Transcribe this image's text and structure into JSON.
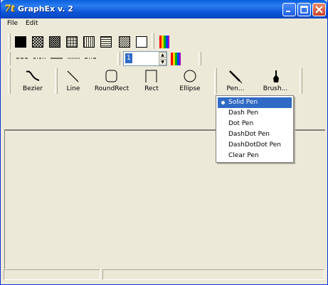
{
  "window": {
    "title": "GraphEx v. 2",
    "app_icon": "7t-app-icon"
  },
  "menu": {
    "items": [
      "File",
      "Edit"
    ]
  },
  "brushes": {
    "styles": [
      "solid",
      "diag-cross",
      "cross-hatch",
      "grid",
      "vertical",
      "horizontal",
      "diagonal",
      "clear"
    ],
    "palette_icon": "color-palette-icon"
  },
  "pen_styles": {
    "items": [
      "dash",
      "dot",
      "solid",
      "dotted",
      "dashdot"
    ]
  },
  "spin": {
    "value": "1"
  },
  "shapes": [
    {
      "label": "Bezier",
      "icon": "bezier-icon"
    },
    {
      "label": "Line",
      "icon": "line-icon"
    },
    {
      "label": "RoundRect",
      "icon": "roundrect-icon"
    },
    {
      "label": "Rect",
      "icon": "rect-icon"
    },
    {
      "label": "Ellipse",
      "icon": "ellipse-icon"
    }
  ],
  "tools": [
    {
      "label": "Pen...",
      "icon": "pen-icon"
    },
    {
      "label": "Brush...",
      "icon": "brush-icon"
    }
  ],
  "dropdown": {
    "items": [
      "Solid Pen",
      "Dash Pen",
      "Dot Pen",
      "DashDot Pen",
      "DashDotDot Pen",
      "Clear Pen"
    ],
    "selected": 0
  },
  "colors": {
    "accent": "#316ac5",
    "title_bar": "#0a5fde",
    "face": "#ece9d8"
  }
}
